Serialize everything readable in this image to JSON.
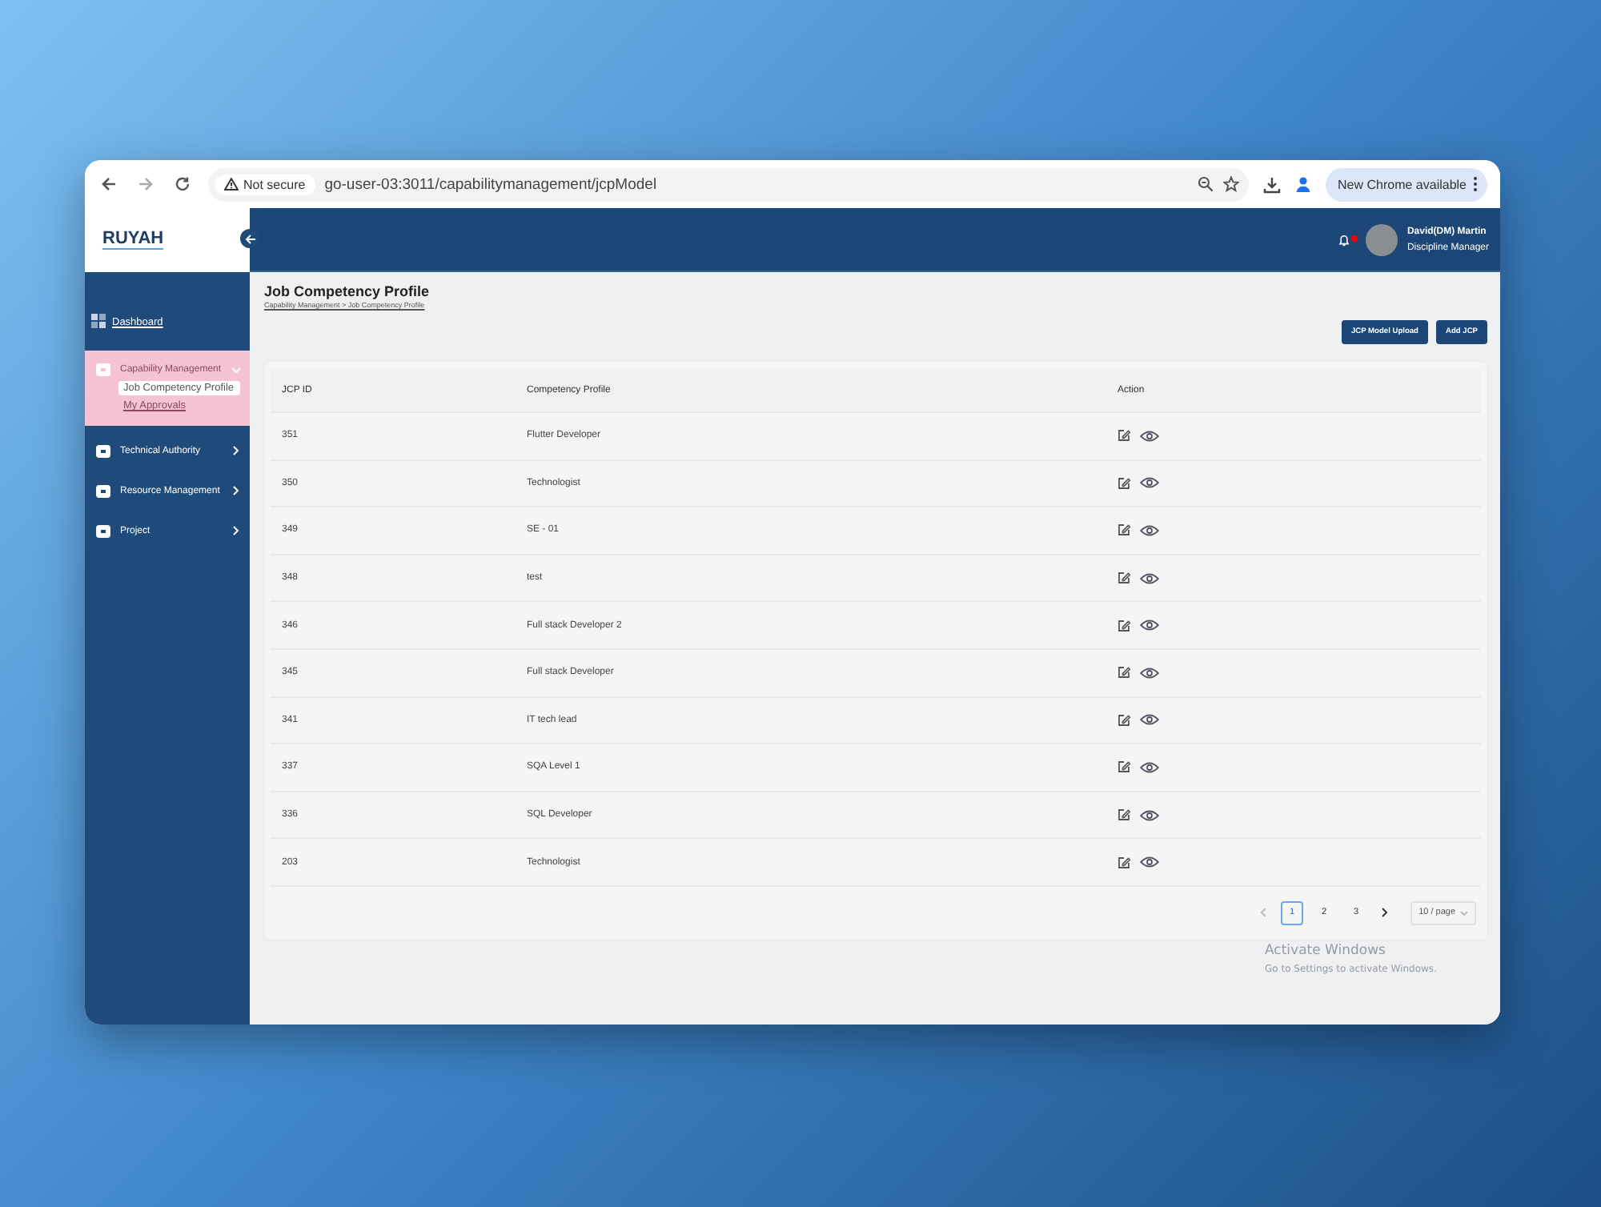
{
  "browser": {
    "security": "Not secure",
    "url": "go-user-03:3011/capabilitymanagement/jcpModel",
    "update_button": "New Chrome available"
  },
  "sidebar": {
    "logo": "RUYAH",
    "items": [
      {
        "kind": "link",
        "label": "Dashboard"
      },
      {
        "kind": "group",
        "label": "Capability Management",
        "expanded": true,
        "children": [
          {
            "label": "Job Competency Profile",
            "selected": true
          },
          {
            "label": "My Approvals",
            "selected": false
          }
        ]
      },
      {
        "kind": "group",
        "label": "Technical Authority",
        "expanded": false
      },
      {
        "kind": "group",
        "label": "Resource Management",
        "expanded": false
      },
      {
        "kind": "group",
        "label": "Project",
        "expanded": false
      }
    ]
  },
  "header": {
    "notifications_unread": true,
    "user_name": "David(DM) Martin",
    "user_role": "Discipline Manager"
  },
  "page": {
    "title": "Job Competency Profile",
    "breadcrumb": "Capability Management > Job Competency Profile",
    "buttons": [
      "JCP Model Upload",
      "Add JCP"
    ]
  },
  "table": {
    "columns": [
      "JCP ID",
      "Competency Profile",
      "Action"
    ],
    "rows": [
      {
        "id": "351",
        "profile": "Flutter Developer"
      },
      {
        "id": "350",
        "profile": "Technologist"
      },
      {
        "id": "349",
        "profile": "SE - 01"
      },
      {
        "id": "348",
        "profile": "test"
      },
      {
        "id": "346",
        "profile": "Full stack Developer 2"
      },
      {
        "id": "345",
        "profile": "Full stack Developer"
      },
      {
        "id": "341",
        "profile": "IT tech lead"
      },
      {
        "id": "337",
        "profile": "SQA Level 1"
      },
      {
        "id": "336",
        "profile": "SQL Developer"
      },
      {
        "id": "203",
        "profile": "Technologist"
      }
    ]
  },
  "pagination": {
    "pages": [
      {
        "label": "1",
        "selected": true
      },
      {
        "label": "2",
        "selected": false
      },
      {
        "label": "3",
        "selected": false
      }
    ],
    "page_size": "10 / page"
  },
  "os_notice": {
    "title": "Activate Windows",
    "text": "Go to Settings to activate Windows."
  }
}
